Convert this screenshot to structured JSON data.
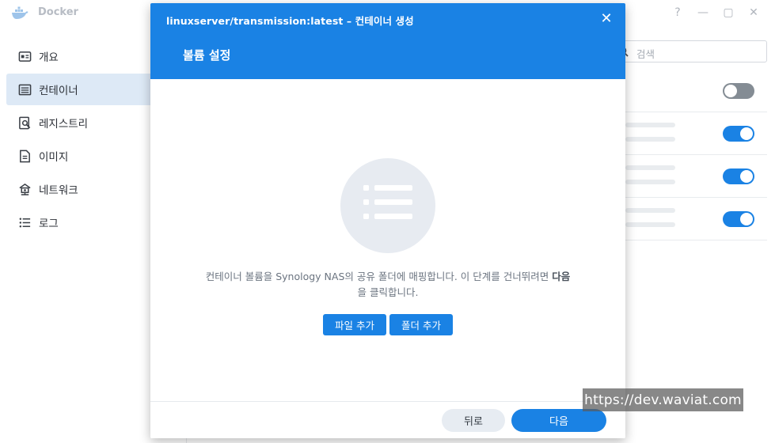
{
  "app": {
    "title": "Docker",
    "window_controls": [
      "?",
      "—",
      "▢",
      "✕"
    ]
  },
  "sidebar": {
    "items": [
      {
        "label": "개요",
        "icon": "overview-icon",
        "active": false
      },
      {
        "label": "컨테이너",
        "icon": "container-list-icon",
        "active": true
      },
      {
        "label": "레지스트리",
        "icon": "registry-search-icon",
        "active": false
      },
      {
        "label": "이미지",
        "icon": "image-file-icon",
        "active": false
      },
      {
        "label": "네트워크",
        "icon": "network-icon",
        "active": false
      },
      {
        "label": "로그",
        "icon": "log-list-icon",
        "active": false
      }
    ]
  },
  "search": {
    "placeholder": "검색"
  },
  "list": {
    "toggles": [
      false,
      true,
      true,
      true
    ]
  },
  "modal": {
    "title": "linuxserver/transmission:latest – 컨테이너 생성",
    "close_symbol": "✕",
    "step_title": "볼륨 설정",
    "description_part1": "컨테이너 볼륨을 Synology NAS의 공유 폴더에 매핑합니다. 이 단계를 건너뛰려면 ",
    "description_strong": "다음",
    "description_part2": "을 클릭합니다.",
    "add_file_label": "파일 추가",
    "add_folder_label": "폴더 추가",
    "back_label": "뒤로",
    "next_label": "다음"
  },
  "watermark": "https://dev.waviat.com",
  "colors": {
    "accent": "#1a82e4",
    "sidebar_active": "#dde9f6",
    "toggle_off": "#848c94",
    "illustration_bg": "#e7ebf1"
  }
}
